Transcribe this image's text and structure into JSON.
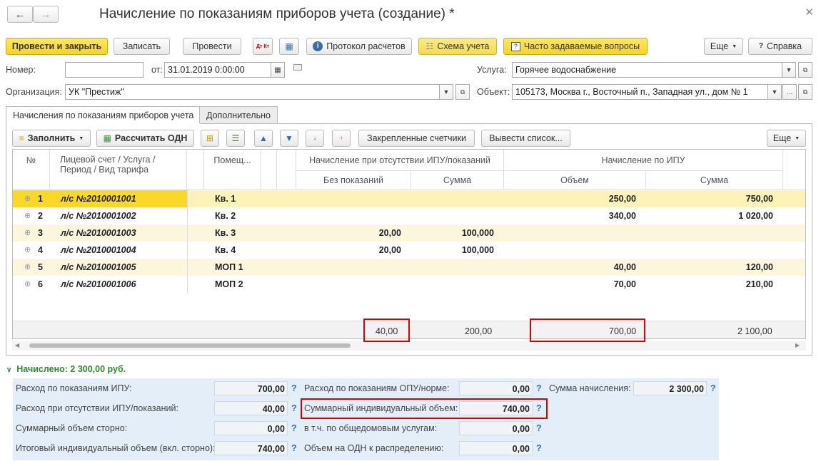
{
  "window": {
    "title": "Начисление по показаниям приборов учета (создание) *"
  },
  "toolbar": {
    "post_close": "Провести и закрыть",
    "save": "Записать",
    "post": "Провести",
    "protocol": "Протокол расчетов",
    "scheme": "Схема учета",
    "faq": "Часто задаваемые вопросы",
    "more": "Еще",
    "help": "Справка",
    "dtkt_icon": "Дт Кт"
  },
  "form": {
    "number_label": "Номер:",
    "number_value": "",
    "from_label": "от:",
    "date_value": "31.01.2019  0:00:00",
    "service_label": "Услуга:",
    "service_value": "Горячее водоснабжение",
    "org_label": "Организация:",
    "org_value": "УК \"Престиж\"",
    "object_label": "Объект:",
    "object_value": "105173, Москва г., Восточный п., Западная ул., дом № 1"
  },
  "tabs": [
    "Начисления по показаниям приборов учета",
    "Дополнительно"
  ],
  "table_toolbar": {
    "fill": "Заполнить",
    "calc_odn": "Рассчитать ОДН",
    "fixed_meters": "Закрепленные счетчики",
    "output_list": "Вывести список...",
    "more": "Еще"
  },
  "table": {
    "headers": {
      "num": "№",
      "account": "Лицевой счет / Услуга / Период / Вид тарифа",
      "room": "Помещ...",
      "no_ipu_group": "Начисление при отсутствии ИПУ/показаний",
      "no_readings": "Без показаний",
      "sum1": "Сумма",
      "ipu_group": "Начисление по ИПУ",
      "volume": "Объем",
      "sum2": "Сумма"
    },
    "rows": [
      {
        "n": "1",
        "account": "л/с №2010001001",
        "room": "Кв. 1",
        "noread": "",
        "sum1": "",
        "vol": "250,00",
        "sum2": "750,00"
      },
      {
        "n": "2",
        "account": "л/с №2010001002",
        "room": "Кв. 2",
        "noread": "",
        "sum1": "",
        "vol": "340,00",
        "sum2": "1 020,00"
      },
      {
        "n": "3",
        "account": "л/с №2010001003",
        "room": "Кв. 3",
        "noread": "20,00",
        "sum1": "100,000",
        "vol": "",
        "sum2": ""
      },
      {
        "n": "4",
        "account": "л/с №2010001004",
        "room": "Кв. 4",
        "noread": "20,00",
        "sum1": "100,000",
        "vol": "",
        "sum2": ""
      },
      {
        "n": "5",
        "account": "л/с №2010001005",
        "room": "МОП 1",
        "noread": "",
        "sum1": "",
        "vol": "40,00",
        "sum2": "120,00"
      },
      {
        "n": "6",
        "account": "л/с №2010001006",
        "room": "МОП 2",
        "noread": "",
        "sum1": "",
        "vol": "70,00",
        "sum2": "210,00"
      }
    ],
    "totals": {
      "noread": "40,00",
      "sum1": "200,00",
      "vol": "700,00",
      "sum2": "2 100,00"
    }
  },
  "summary": {
    "header": "Начислено: 2 300,00 руб.",
    "ipu_label": "Расход по показаниям ИПУ:",
    "ipu_value": "700,00",
    "no_ipu_label": "Расход при отсутствии ИПУ/показаний:",
    "no_ipu_value": "40,00",
    "storno_label": "Суммарный объем сторно:",
    "storno_value": "0,00",
    "total_ind_label": "Итоговый индивидуальный объем (вкл. сторно):",
    "total_ind_value": "740,00",
    "opu_label": "Расход по показаниям ОПУ/норме:",
    "opu_value": "0,00",
    "sum_ind_label": "Суммарный индивидуальный объем:",
    "sum_ind_value": "740,00",
    "common_label": "в т.ч. по общедомовым услугам:",
    "common_value": "0,00",
    "odn_label": "Объем на ОДН к распределению:",
    "odn_value": "0,00",
    "accrual_label": "Сумма начисления:",
    "accrual_value": "2 300,00",
    "q": "?"
  }
}
